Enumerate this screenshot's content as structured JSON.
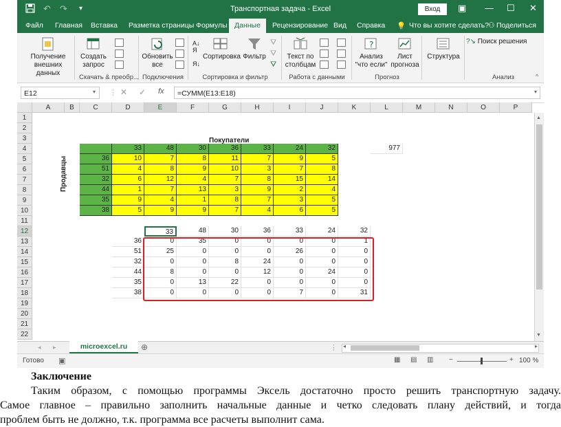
{
  "window": {
    "title": "Транспортная задача  -  Excel",
    "login_label": "Вход",
    "colors": {
      "brand": "#217346",
      "yellow": "#ffff00",
      "green": "#5cb346",
      "red_border": "#e01b24"
    }
  },
  "ribbon": {
    "tabs": [
      "Файл",
      "Главная",
      "Вставка",
      "Разметка страницы",
      "Формулы",
      "Данные",
      "Рецензирование",
      "Вид",
      "Справка"
    ],
    "active_tab": "Данные",
    "tell_me": "Что вы хотите сделать?",
    "share": "Поделиться",
    "buttons": {
      "get_data": "Получение внешних данных",
      "create_query": "Создать запрос",
      "refresh_all": "Обновить все",
      "sort": "Сортировка",
      "filter": "Фильтр",
      "text_to_columns": "Текст по столбцам",
      "what_if": "Анализ \"что если\"",
      "forecast": "Лист прогноза",
      "outline": "Структура",
      "solver": "Поиск решения"
    },
    "groups": {
      "get_transform": "Скачать & преобр...",
      "connections": "Подключения",
      "sort_filter": "Сортировка и фильтр",
      "data_tools": "Работа с данными",
      "forecast": "Прогноз",
      "analysis": "Анализ"
    }
  },
  "formula_bar": {
    "name_box": "E12",
    "formula": "=СУММ(E13:E18)"
  },
  "sheet": {
    "columns": [
      "A",
      "B",
      "C",
      "D",
      "E",
      "F",
      "G",
      "H",
      "I",
      "J",
      "K",
      "L",
      "M",
      "N",
      "O",
      "P"
    ],
    "rows": [
      "1",
      "2",
      "3",
      "4",
      "5",
      "6",
      "7",
      "8",
      "9",
      "10",
      "11",
      "12",
      "13",
      "14",
      "15",
      "16",
      "17",
      "18",
      "19",
      "20",
      "21",
      "22"
    ],
    "buyers_label": "Покупатели",
    "sellers_label": "Продавцы",
    "demand": [
      "33",
      "48",
      "30",
      "36",
      "33",
      "24",
      "32"
    ],
    "supply": [
      "36",
      "51",
      "32",
      "44",
      "35",
      "38"
    ],
    "costs": [
      [
        "10",
        "7",
        "8",
        "11",
        "7",
        "9",
        "5"
      ],
      [
        "4",
        "8",
        "9",
        "10",
        "3",
        "7",
        "8"
      ],
      [
        "6",
        "12",
        "4",
        "7",
        "8",
        "15",
        "14"
      ],
      [
        "1",
        "7",
        "13",
        "3",
        "9",
        "2",
        "4"
      ],
      [
        "9",
        "4",
        "1",
        "8",
        "7",
        "3",
        "5"
      ],
      [
        "5",
        "9",
        "9",
        "7",
        "4",
        "6",
        "5"
      ]
    ],
    "total": "977",
    "result_demand": [
      "33",
      "48",
      "30",
      "36",
      "33",
      "24",
      "32"
    ],
    "result_supply": [
      "36",
      "51",
      "32",
      "44",
      "35",
      "38"
    ],
    "result": [
      [
        "0",
        "35",
        "0",
        "0",
        "0",
        "0",
        "1"
      ],
      [
        "25",
        "0",
        "0",
        "0",
        "26",
        "0",
        "0"
      ],
      [
        "0",
        "0",
        "8",
        "24",
        "0",
        "0",
        "0"
      ],
      [
        "8",
        "0",
        "0",
        "12",
        "0",
        "24",
        "0"
      ],
      [
        "0",
        "13",
        "22",
        "0",
        "0",
        "0",
        "0"
      ],
      [
        "0",
        "0",
        "0",
        "0",
        "7",
        "0",
        "31"
      ]
    ],
    "sheet_tab": "microexcel.ru"
  },
  "status": {
    "ready": "Готово",
    "zoom": "100 %"
  },
  "document": {
    "heading": "Заключение",
    "line1": "Таким образом, с помощью программы Эксель достаточно просто решить транспортную задачу.",
    "line2": "Самое главное – правильно заполнить начальные данные и четко следовать плану действий, и тогда",
    "line3": "проблем быть не должно, т.к. программа все расчеты выполнит сама."
  }
}
